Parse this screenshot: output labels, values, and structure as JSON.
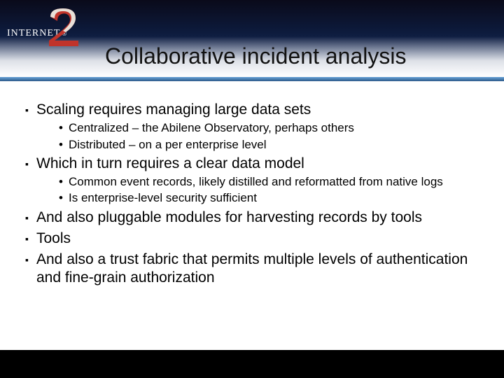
{
  "logo": {
    "brand_left": "INTERNET",
    "brand_reg": "®"
  },
  "title": "Collaborative incident analysis",
  "bullets": [
    {
      "level": 1,
      "text": "Scaling requires managing large data sets"
    },
    {
      "level": 2,
      "text": "Centralized – the Abilene Observatory, perhaps others"
    },
    {
      "level": 2,
      "text": "Distributed – on a per enterprise level"
    },
    {
      "level": 1,
      "text": "Which in turn requires a clear data model"
    },
    {
      "level": 2,
      "text": "Common event records, likely distilled and reformatted from native logs"
    },
    {
      "level": 2,
      "text": "Is enterprise-level security sufficient"
    },
    {
      "level": 1,
      "text": "And also pluggable modules for harvesting records by tools"
    },
    {
      "level": 1,
      "text": "Tools"
    },
    {
      "level": 1,
      "text": "And also a trust fabric that permits multiple levels of authentication and fine-grain authorization"
    }
  ],
  "markers": {
    "l1": "▪",
    "l2": "•"
  }
}
